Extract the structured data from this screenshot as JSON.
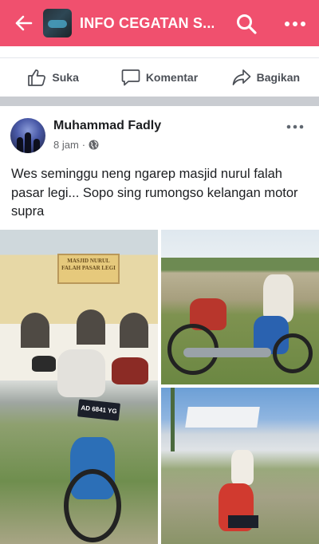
{
  "topbar": {
    "title": "INFO CEGATAN S...",
    "bg_color": "#f0506e",
    "back_icon": "back-arrow-icon",
    "search_icon": "search-icon",
    "more_icon": "more-horizontal-icon"
  },
  "actions": {
    "like_label": "Suka",
    "comment_label": "Komentar",
    "share_label": "Bagikan"
  },
  "post": {
    "author": "Muhammad Fadly",
    "time": "8 jam",
    "privacy_icon": "globe-icon",
    "text": "Wes seminggu neng ngarep masjid nurul falah pasar legi... Sopo sing rumongso kelangan motor supra"
  },
  "photos": {
    "photo1_plate": "AD 6841 YG",
    "photo1_sign": "MASJID NURUL FALAH PASAR LEGI"
  }
}
